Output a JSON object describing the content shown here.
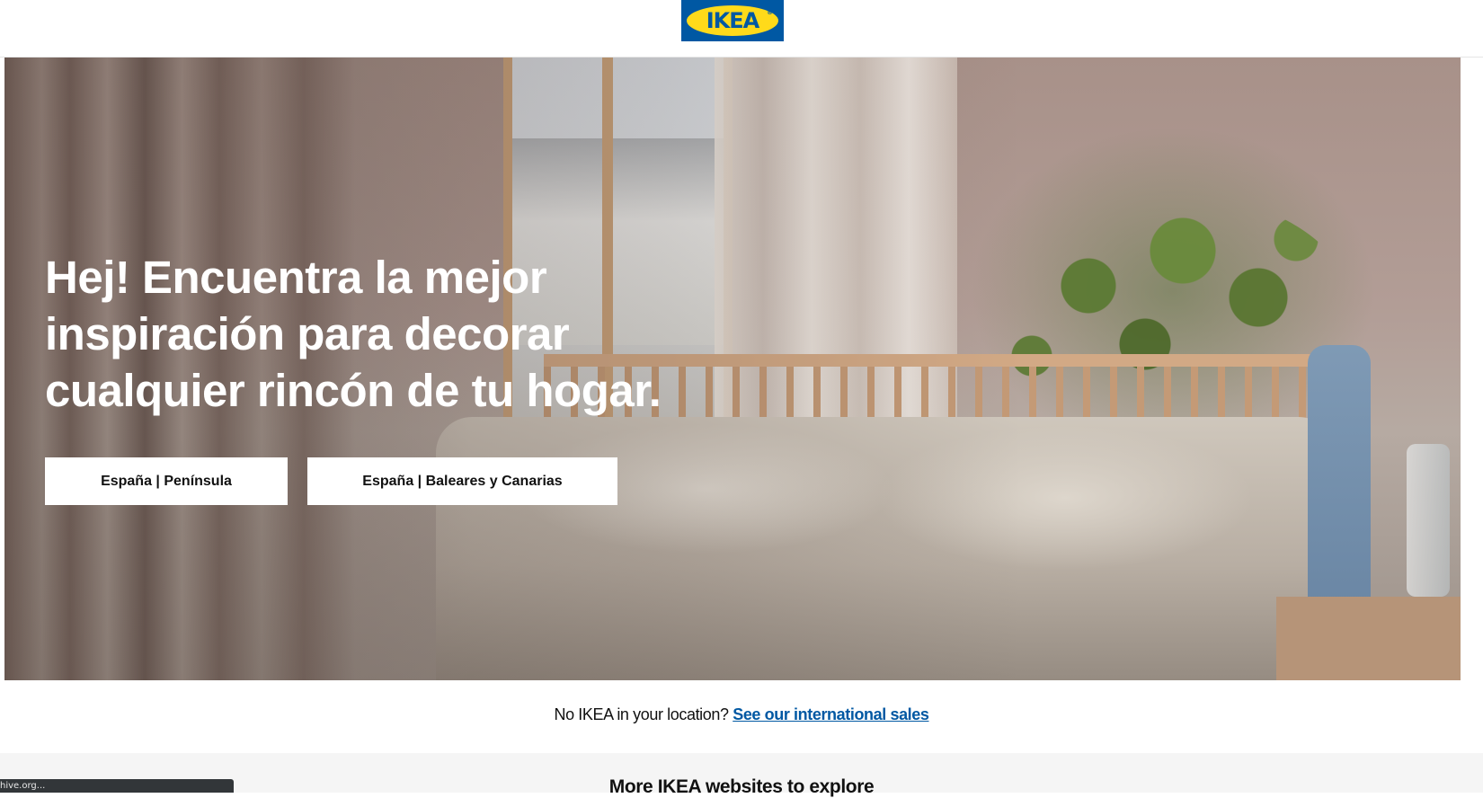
{
  "header": {
    "logo_text": "IKEA",
    "logo_reg": "®",
    "logo_colors": {
      "background": "#0058a3",
      "oval": "#ffda1a",
      "text": "#0058a3"
    }
  },
  "hero": {
    "heading": "Hej! Encuentra la mejor inspiración para decorar cualquier rincón de tu hogar.",
    "buttons": [
      {
        "label": "España | Península"
      },
      {
        "label": "España | Baleares y Canarias"
      }
    ]
  },
  "notice": {
    "text": "No IKEA in your location?",
    "link_label": "See our international sales",
    "link_color": "#0058a3"
  },
  "explore": {
    "title": "More IKEA websites to explore"
  },
  "status_bar": {
    "text": "hive.org..."
  }
}
